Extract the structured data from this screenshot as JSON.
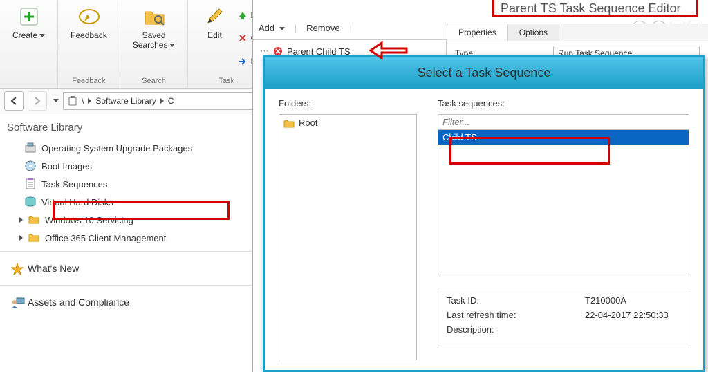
{
  "ribbon": {
    "create_label": "Create",
    "feedback_label": "Feedback",
    "saved_searches_label": "Saved\nSearches",
    "edit_label": "Edit",
    "group_feedback": "Feedback",
    "group_search": "Search",
    "group_task": "Task",
    "side_e": "E",
    "side_c": "C",
    "side_e2": "E"
  },
  "breadcrumb": {
    "root": "\\",
    "item1": "Software Library",
    "item2": "C"
  },
  "tree": {
    "title": "Software Library",
    "items": [
      "Operating System Upgrade Packages",
      "Boot Images",
      "Task Sequences",
      "Virtual Hard Disks"
    ],
    "categories": [
      "Windows 10 Servicing",
      "Office 365 Client Management"
    ],
    "whats_new": "What's New",
    "assets": "Assets and Compliance"
  },
  "editor": {
    "title": "Parent TS Task Sequence Editor",
    "toolbar": {
      "add": "Add",
      "remove": "Remove"
    },
    "tree_node": "Parent Child TS",
    "tabs": {
      "properties": "Properties",
      "options": "Options"
    },
    "type_label": "Type:",
    "type_value": "Run Task Sequence"
  },
  "dialog": {
    "title": "Select a Task Sequence",
    "folders_label": "Folders:",
    "folder_root": "Root",
    "seqs_label": "Task sequences:",
    "filter_placeholder": "Filter...",
    "seq_item": "Child TS",
    "info": {
      "task_id_k": "Task ID:",
      "task_id_v": "T210000A",
      "refresh_k": "Last refresh time:",
      "refresh_v": "22-04-2017 22:50:33",
      "desc_k": "Description:"
    }
  }
}
